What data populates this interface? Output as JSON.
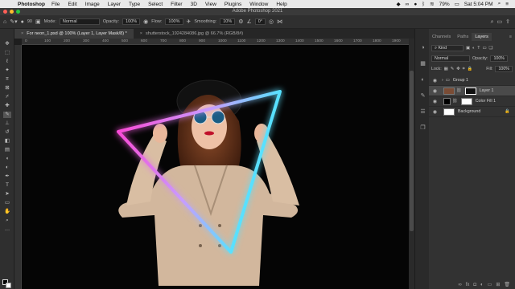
{
  "menubar": {
    "app_name": "Photoshop",
    "items": [
      "File",
      "Edit",
      "Image",
      "Layer",
      "Type",
      "Select",
      "Filter",
      "3D",
      "View",
      "Plugins",
      "Window",
      "Help"
    ],
    "battery": "79%",
    "clock": "Sat 5:04 PM"
  },
  "window": {
    "title": "Adobe Photoshop 2021"
  },
  "options": {
    "brush_size": "90",
    "mode_label": "Mode:",
    "mode_value": "Normal",
    "opacity_label": "Opacity:",
    "opacity_value": "100%",
    "flow_label": "Flow:",
    "flow_value": "100%",
    "smoothing_label": "Smoothing:",
    "smoothing_value": "10%",
    "angle_value": "0°"
  },
  "tabs": [
    {
      "label": "For neon_1.psd @ 100% (Layer 1, Layer Mask/8) *"
    },
    {
      "label": "shutterstock_1924284086.jpg @ 66.7% (RGB/8#)"
    }
  ],
  "ruler_ticks": [
    "0",
    "100",
    "200",
    "300",
    "400",
    "500",
    "600",
    "700",
    "800",
    "900",
    "1000",
    "1100",
    "1200",
    "1300",
    "1400",
    "1500",
    "1600",
    "1700",
    "1800",
    "1900"
  ],
  "layers_panel": {
    "tabs": [
      "Channels",
      "Paths",
      "Layers"
    ],
    "kind_label": "Kind",
    "blend_mode": "Normal",
    "opacity_label": "Opacity:",
    "opacity_value": "100%",
    "lock_label": "Lock:",
    "fill_label": "Fill:",
    "fill_value": "100%",
    "layers": [
      {
        "name": "Group 1"
      },
      {
        "name": "Layer 1"
      },
      {
        "name": "Color Fill 1"
      },
      {
        "name": "Background"
      }
    ]
  },
  "colors": {
    "neon_pink": "#ff3fd0",
    "neon_cyan": "#3ff0ff",
    "foreground": "#000000",
    "background": "#ffffff"
  }
}
